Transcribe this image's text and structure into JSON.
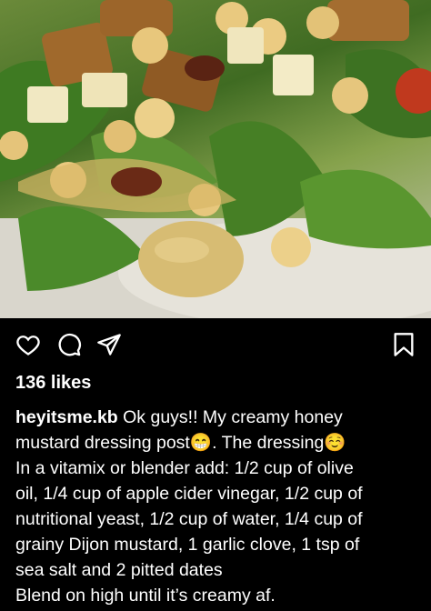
{
  "post": {
    "photo_description_icon": "salad-photo",
    "likes": "136 likes",
    "username": "heyitsme.kb",
    "caption_lines": [
      " Ok guys!! My creamy honey",
      "mustard dressing post",
      ". The dressing",
      "In a vitamix or blender add: 1/2 cup of olive",
      "oil, 1/4 cup of apple cider vinegar, 1/2 cup of",
      "nutritional yeast, 1/2 cup of water, 1/4 cup of",
      "grainy Dijon mustard, 1 garlic clove, 1 tsp of",
      "sea salt and 2 pitted dates",
      "Blend on high until it’s creamy af."
    ],
    "emoji_1": "😁",
    "emoji_2": "☺️"
  },
  "actions": {
    "like_icon": "heart-icon",
    "comment_icon": "comment-icon",
    "share_icon": "send-icon",
    "save_icon": "bookmark-icon"
  }
}
